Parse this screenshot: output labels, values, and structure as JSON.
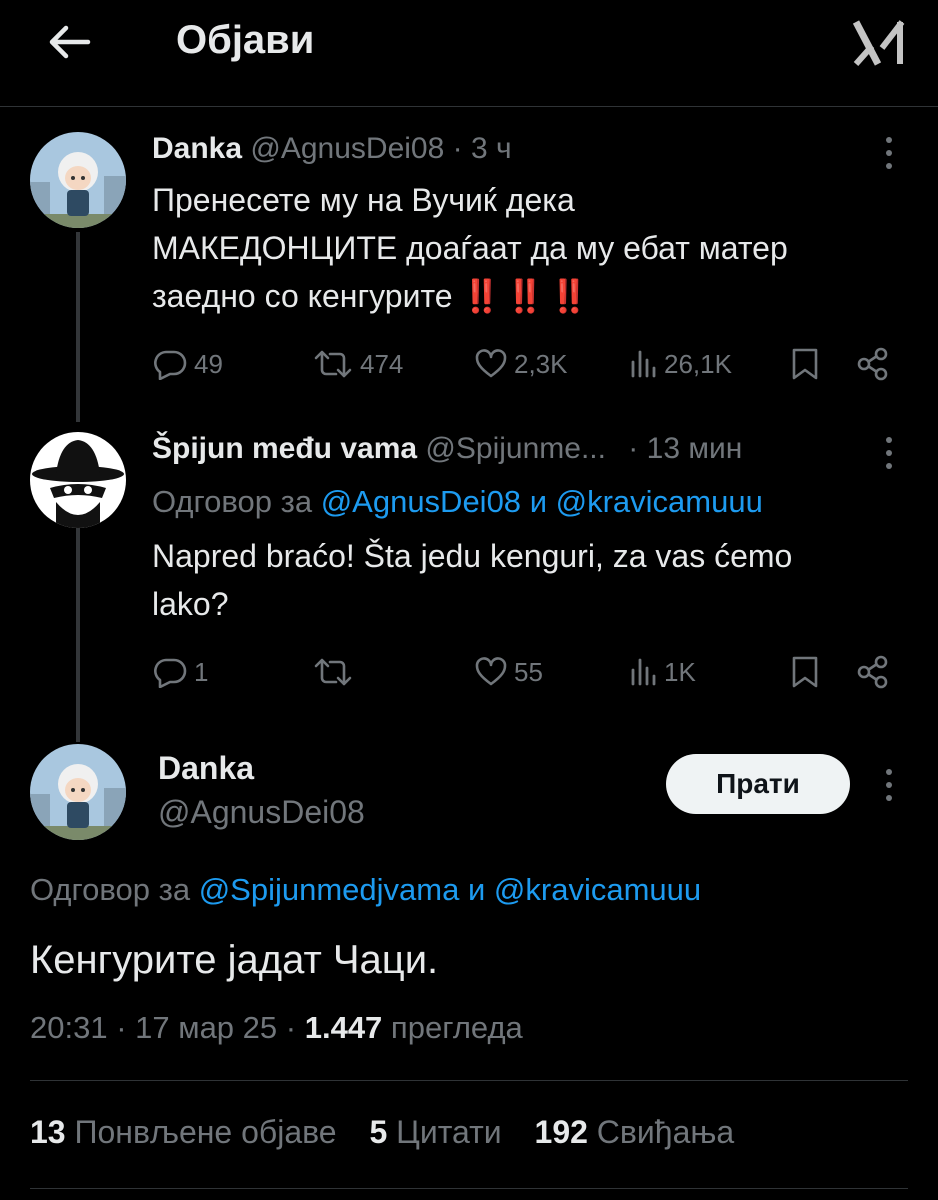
{
  "header": {
    "title": "Објави",
    "back_icon": "arrow-left-icon",
    "logo_icon": "x-grok-logo-icon"
  },
  "tweets": [
    {
      "name": "Danka",
      "handle": "@AgnusDei08",
      "dot": "·",
      "time": "3 ч",
      "text_lines": [
        "Пренесете му на Вучиќ дека",
        "МАКЕДОНЦИТЕ  доаѓаат да му ебат матер",
        "заедно со кенгурите"
      ],
      "emoji": "‼️‼️‼️",
      "replies": "49",
      "reposts": "474",
      "likes": "2,3K",
      "views": "26,1K"
    },
    {
      "name": "Špijun među vama",
      "handle": "@Spijunme...",
      "dot": "·",
      "time": "13 мин",
      "reply_prefix": "Одговор за",
      "reply_user1": "@AgnusDei08",
      "reply_and": "и",
      "reply_user2": "@kravicamuuu",
      "text_lines": [
        "Napred braćo! Šta jedu kenguri, za vas ćemo",
        "lako?"
      ],
      "replies": "1",
      "reposts": "",
      "likes": "55",
      "views": "1K"
    }
  ],
  "main_tweet": {
    "name": "Danka",
    "handle": "@AgnusDei08",
    "follow_label": "Прати",
    "reply_prefix": "Одговор за",
    "reply_user1": "@Spijunmedjvama",
    "reply_and": "и",
    "reply_user2": "@kravicamuuu",
    "text": "Кенгурите јадат Чаци.",
    "time": "20:31",
    "dot": "·",
    "date": "17 мар 25",
    "views_count": "1.447",
    "views_label": "прегледа",
    "stats": {
      "reposts_count": "13",
      "reposts_label": "Понвљене објаве",
      "quotes_count": "5",
      "quotes_label": "Цитати",
      "likes_count": "192",
      "likes_label": "Свиђања"
    }
  },
  "colors": {
    "background": "#000000",
    "text": "#e7e9ea",
    "muted": "#71767b",
    "link": "#1d9bf0",
    "divider": "#2f3336"
  }
}
